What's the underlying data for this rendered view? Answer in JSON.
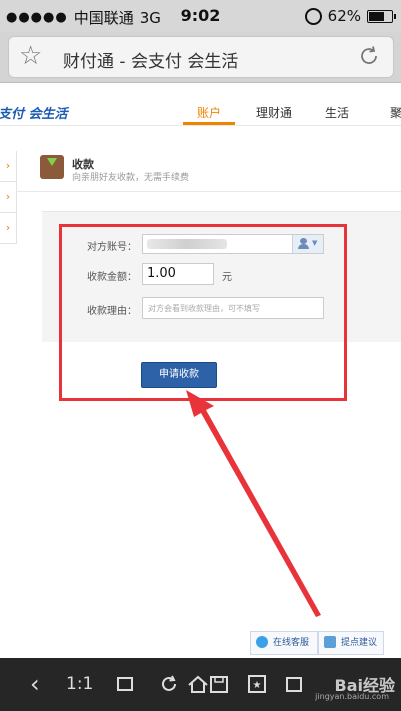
{
  "status_bar": {
    "carrier": "中国联通",
    "network": "3G",
    "time": "9:02",
    "battery": "62%"
  },
  "address_bar": {
    "title": "财付通 - 会支付 会生活"
  },
  "site": {
    "logo": "支付 会生活",
    "nav": [
      "账户",
      "理财通",
      "生活",
      "聚"
    ],
    "active_nav": "账户"
  },
  "section": {
    "title": "收款",
    "subtitle": "向亲朋好友收款，无需手续费"
  },
  "form": {
    "account_label": "对方账号：",
    "amount_label": "收款金额：",
    "amount_value": "1.00",
    "amount_unit": "元",
    "reason_label": "收款理由：",
    "reason_placeholder": "对方会看到收款理由，可不填写",
    "submit_label": "申请收款"
  },
  "help": {
    "online_service": "在线客服",
    "suggestion": "提点建议"
  },
  "toolbar": {
    "zoom": "1:1",
    "watermark": "Bai经验",
    "watermark_url": "jingyan.baidu.com"
  },
  "colors": {
    "accent_orange": "#f08300",
    "primary_blue": "#2d62a8",
    "highlight_red": "#e8333a"
  }
}
